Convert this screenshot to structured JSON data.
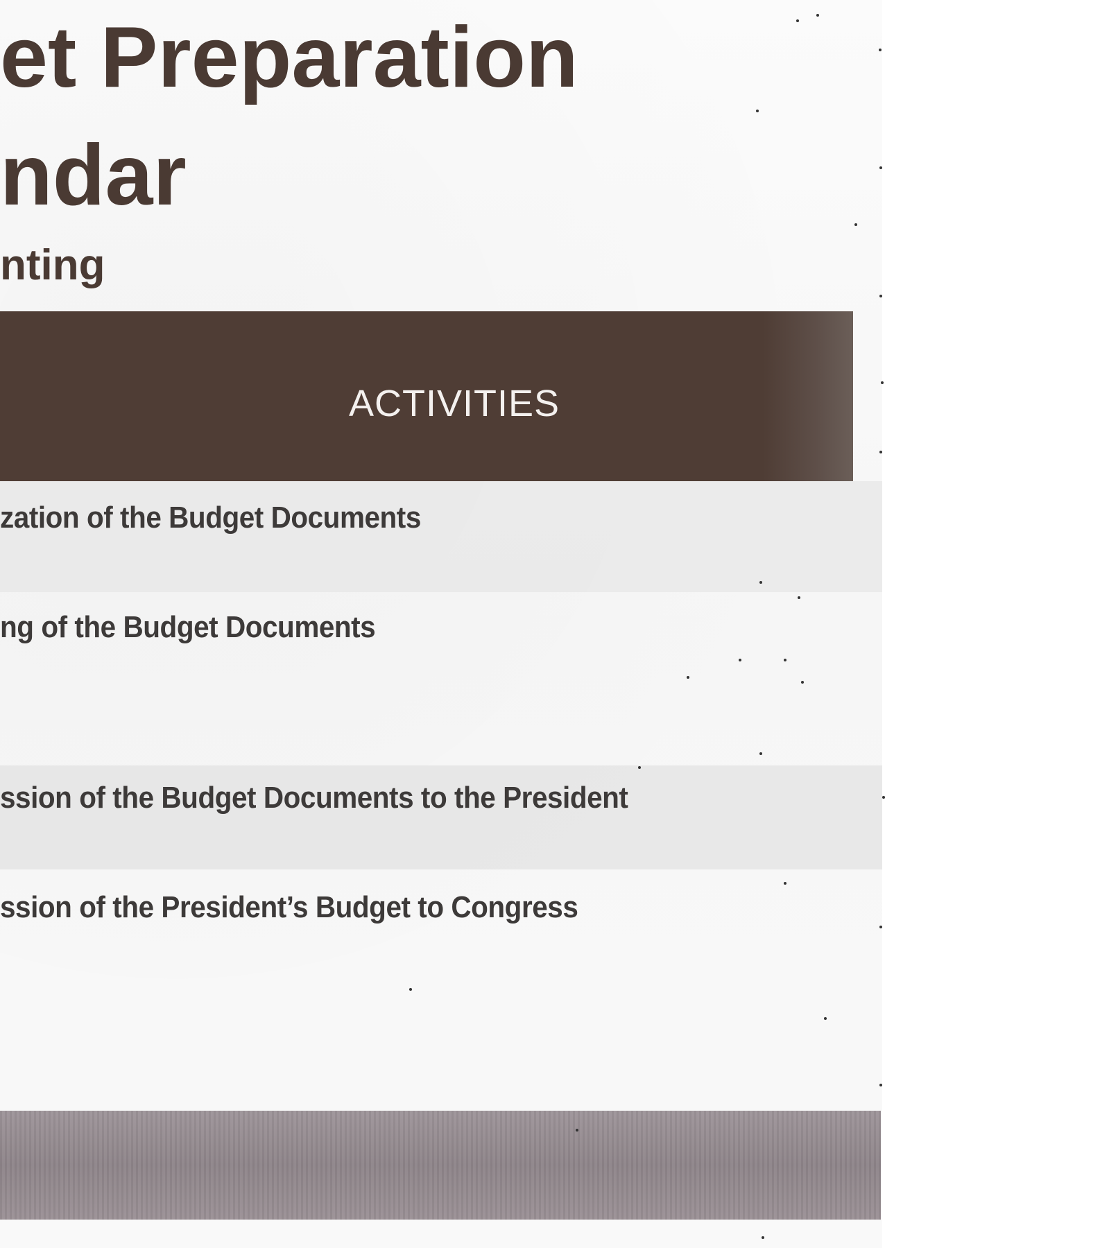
{
  "document": {
    "title_line_1": "et Preparation",
    "title_line_2": "ndar",
    "subtitle": "nting",
    "table": {
      "header": "ACTIVITIES",
      "rows": [
        "zation of the Budget Documents",
        "ng of the Budget Documents",
        "ssion of the Budget Documents to the President",
        "ssion of the President’s Budget to Congress"
      ]
    }
  },
  "colors": {
    "title_text": "#4a3a33",
    "header_bar": "#4f3d35",
    "header_text": "#f4f1ef",
    "row_text": "#3d3a39",
    "footer_bar": "#938a8f"
  }
}
